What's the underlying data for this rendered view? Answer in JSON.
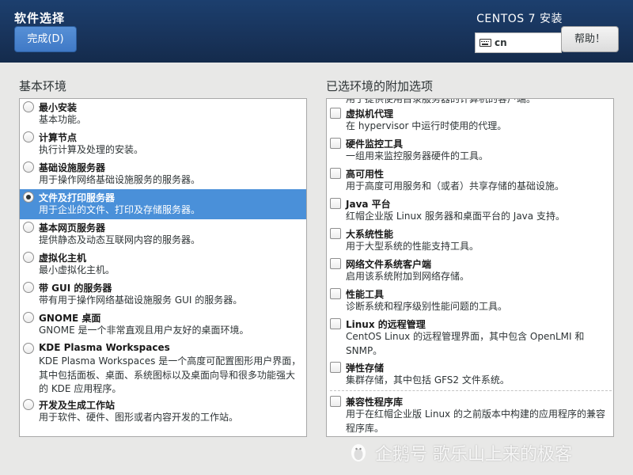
{
  "header": {
    "title": "软件选择",
    "done_label": "完成(D)",
    "product": "CENTOS 7 安装",
    "keyboard_layout": "cn",
    "help_label": "帮助！"
  },
  "base_env": {
    "title": "基本环境",
    "items": [
      {
        "name": "最小安装",
        "desc": "基本功能。"
      },
      {
        "name": "计算节点",
        "desc": "执行计算及处理的安装。"
      },
      {
        "name": "基础设施服务器",
        "desc": "用于操作网络基础设施服务的服务器。"
      },
      {
        "name": "文件及打印服务器",
        "desc": "用于企业的文件、打印及存储服务器。"
      },
      {
        "name": "基本网页服务器",
        "desc": "提供静态及动态互联网内容的服务器。"
      },
      {
        "name": "虚拟化主机",
        "desc": "最小虚拟化主机。"
      },
      {
        "name": "带 GUI 的服务器",
        "desc": "带有用于操作网络基础设施服务 GUI 的服务器。"
      },
      {
        "name": "GNOME 桌面",
        "desc": "GNOME 是一个非常直观且用户友好的桌面环境。"
      },
      {
        "name": "KDE Plasma Workspaces",
        "desc": "KDE Plasma Workspaces 是一个高度可配置图形用户界面，其中包括面板、桌面、系统图标以及桌面向导和很多功能强大的 KDE 应用程序。"
      },
      {
        "name": "开发及生成工作站",
        "desc": "用于软件、硬件、图形或者内容开发的工作站。"
      }
    ],
    "selected_index": 3
  },
  "addons": {
    "title": "已选环境的附加选项",
    "cut_text": "用于提供使用目录服务器的计算机的客户端。",
    "items": [
      {
        "name": "虚拟机代理",
        "desc": "在 hypervisor 中运行时使用的代理。"
      },
      {
        "name": "硬件监控工具",
        "desc": "一组用来监控服务器硬件的工具。"
      },
      {
        "name": "高可用性",
        "desc": "用于高度可用服务和（或者）共享存储的基础设施。"
      },
      {
        "name": "Java 平台",
        "desc": "红帽企业版 Linux 服务器和桌面平台的 Java 支持。"
      },
      {
        "name": "大系统性能",
        "desc": "用于大型系统的性能支持工具。"
      },
      {
        "name": "网络文件系统客户端",
        "desc": "启用该系统附加到网络存储。"
      },
      {
        "name": "性能工具",
        "desc": "诊断系统和程序级别性能问题的工具。"
      },
      {
        "name": "Linux 的远程管理",
        "desc": "CentOS Linux 的远程管理界面，其中包含 OpenLMI 和 SNMP。"
      },
      {
        "name": "弹性存储",
        "desc": "集群存储，其中包括 GFS2 文件系统。"
      },
      {
        "name": "兼容性程序库",
        "desc": "用于在红帽企业版 Linux 的之前版本中构建的应用程序的兼容程序库。"
      }
    ]
  },
  "watermark": {
    "text": "企鹅号 歌乐山上来的极客"
  },
  "colors": {
    "header_bg": "#1c3f6e",
    "accent": "#4a90d9",
    "done_button": "#4a85d0"
  }
}
